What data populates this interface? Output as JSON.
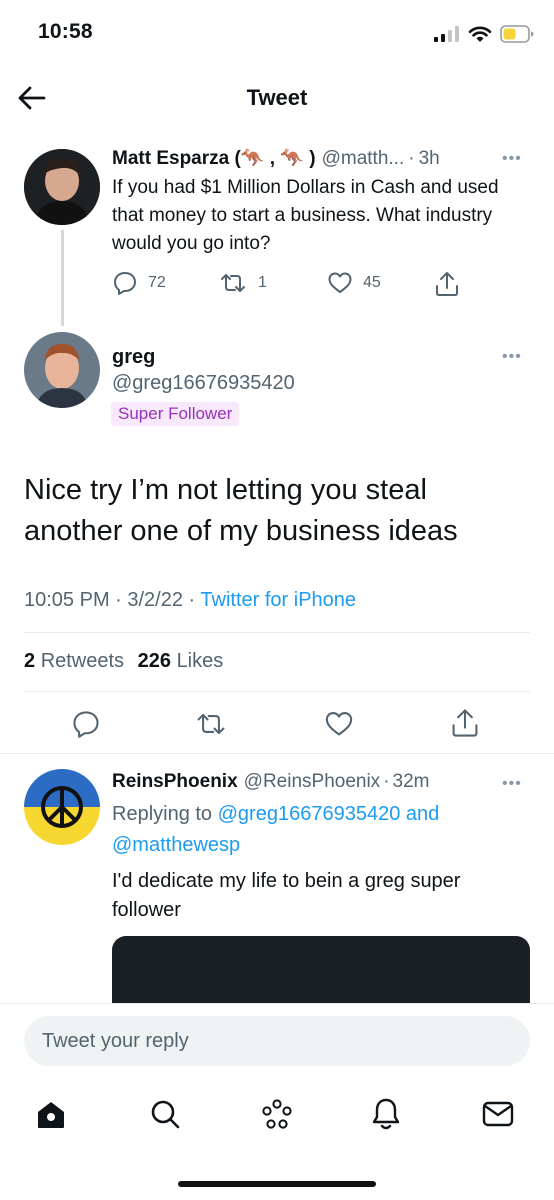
{
  "status_bar": {
    "time": "10:58"
  },
  "header": {
    "title": "Tweet"
  },
  "parent_tweet": {
    "name": "Matt Esparza (🦘 , 🦘 )",
    "handle": "@matth...",
    "separator": "·",
    "time": "3h",
    "more": "•••",
    "text": "If you had $1 Million Dollars in Cash and used that money to start a business. What industry would you go into?",
    "replies": "72",
    "retweets": "1",
    "likes": "45"
  },
  "main_tweet": {
    "name": "greg",
    "handle": "@greg16676935420",
    "badge": "Super Follower",
    "more": "•••",
    "text": "Nice try I’m not letting you steal another one of my business ideas",
    "timestamp": "10:05 PM · 3/2/22 ·",
    "source": "Twitter for iPhone",
    "retweets_count": "2",
    "retweets_label": "Retweets",
    "likes_count": "226",
    "likes_label": "Likes"
  },
  "reply_tweet": {
    "name": "ReinsPhoenix",
    "handle": "@ReinsPhoenix",
    "separator": "·",
    "time": "32m",
    "more": "•••",
    "replying_prefix": "Replying to",
    "replying_user1": "@greg16676935420",
    "replying_and": "and",
    "replying_user2": "@matthewesp",
    "text": "I'd dedicate my life to bein a greg super follower"
  },
  "composer": {
    "placeholder": "Tweet your reply"
  },
  "colors": {
    "accent": "#1d9bf0",
    "super_follower_bg": "#f7e8fb",
    "super_follower_text": "#9932b8"
  },
  "icons": [
    "back-arrow-icon",
    "reply-icon",
    "retweet-icon",
    "like-icon",
    "share-icon",
    "more-icon",
    "home-icon",
    "search-icon",
    "spaces-icon",
    "notifications-icon",
    "messages-icon"
  ]
}
